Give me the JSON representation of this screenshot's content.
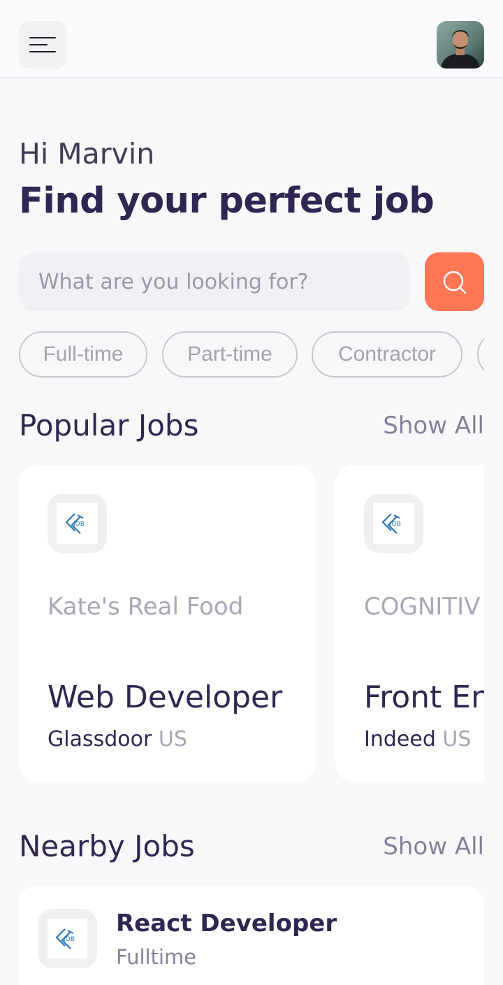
{
  "header": {
    "menu_icon": "menu-icon",
    "avatar": "profile-photo"
  },
  "welcome": {
    "greeting": "Hi Marvin",
    "headline": "Find your perfect job"
  },
  "search": {
    "placeholder": "What are you looking for?",
    "button_icon": "search-icon",
    "accent_color": "#ff7754"
  },
  "job_types": [
    "Full-time",
    "Part-time",
    "Contractor",
    ""
  ],
  "popular": {
    "title": "Popular Jobs",
    "show_all": "Show All",
    "jobs": [
      {
        "logo": "JOB",
        "company": "Kate's Real Food",
        "title": "Web Developer",
        "source": "Glassdoor",
        "country": "US"
      },
      {
        "logo": "JOB",
        "company": "COGNITIV",
        "title": "Front En",
        "source": "Indeed",
        "country": "US"
      }
    ]
  },
  "nearby": {
    "title": "Nearby Jobs",
    "show_all": "Show All",
    "jobs": [
      {
        "logo": "JOB",
        "title": "React Developer",
        "type": "Fulltime"
      }
    ]
  }
}
